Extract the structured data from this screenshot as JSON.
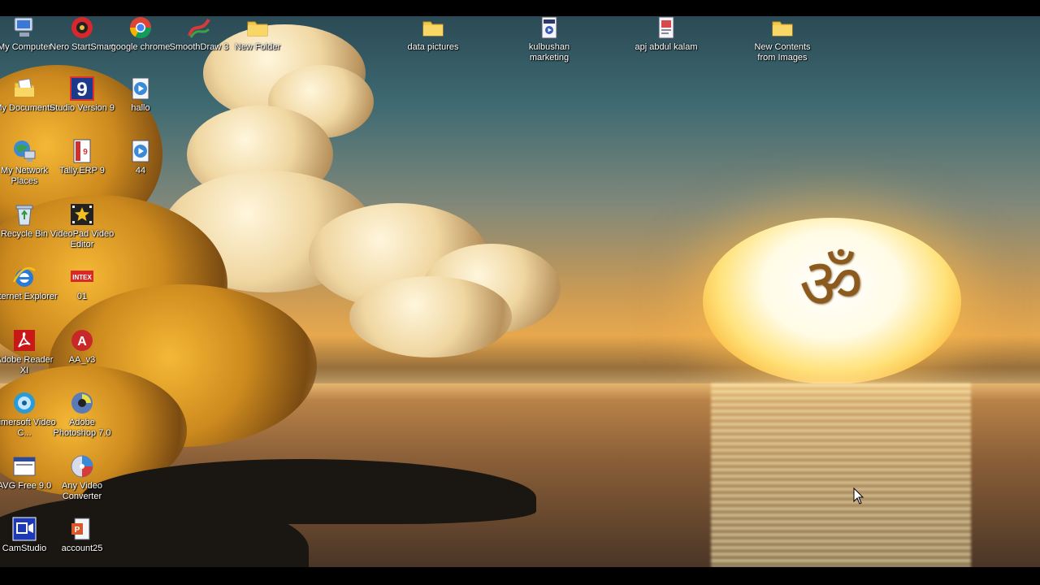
{
  "desktop": {
    "wallpaper_symbol": "ॐ",
    "icons": [
      {
        "label": "My Computer",
        "icon": "computer-icon"
      },
      {
        "label": "Nero StartSmart",
        "icon": "nero-icon"
      },
      {
        "label": "google chrome",
        "icon": "chrome-icon"
      },
      {
        "label": "SmoothDraw 3",
        "icon": "smoothdraw-icon"
      },
      {
        "label": "New Folder",
        "icon": "folder-icon"
      },
      {
        "label": "data pictures",
        "icon": "folder-icon"
      },
      {
        "label": "kulbushan marketing",
        "icon": "video-file-icon"
      },
      {
        "label": "apj abdul kalam",
        "icon": "document-shortcut-icon"
      },
      {
        "label": "New Contents from Images",
        "icon": "folder-icon"
      },
      {
        "label": "My Documents",
        "icon": "documents-folder-icon"
      },
      {
        "label": "Studio Version 9",
        "icon": "studio-icon"
      },
      {
        "label": "hallo",
        "icon": "media-file-icon"
      },
      {
        "label": "My Network Places",
        "icon": "network-icon"
      },
      {
        "label": "Tally.ERP 9",
        "icon": "tally-icon"
      },
      {
        "label": "44",
        "icon": "media-file-icon"
      },
      {
        "label": "Recycle Bin",
        "icon": "recycle-bin-icon"
      },
      {
        "label": "VideoPad Video Editor",
        "icon": "videopad-icon"
      },
      {
        "label": "Internet Explorer",
        "icon": "ie-icon"
      },
      {
        "label": "01",
        "icon": "intex-icon",
        "badge": "INTEX"
      },
      {
        "label": "Adobe Reader XI",
        "icon": "acrobat-icon"
      },
      {
        "label": "AA_v3",
        "icon": "aa-icon"
      },
      {
        "label": "Aimersoft Video C...",
        "icon": "aimersoft-icon"
      },
      {
        "label": "Adobe Photoshop 7.0",
        "icon": "photoshop-icon"
      },
      {
        "label": "AVG Free 9.0",
        "icon": "avg-icon"
      },
      {
        "label": "Any Video Converter",
        "icon": "converter-icon"
      },
      {
        "label": "CamStudio",
        "icon": "camstudio-icon"
      },
      {
        "label": "account25",
        "icon": "powerpoint-icon"
      }
    ]
  },
  "colors": {
    "label_text": "#ffffff",
    "folder": "#f4c94a",
    "sun": "#fffbe4",
    "om_symbol": "#8b5a1c"
  }
}
